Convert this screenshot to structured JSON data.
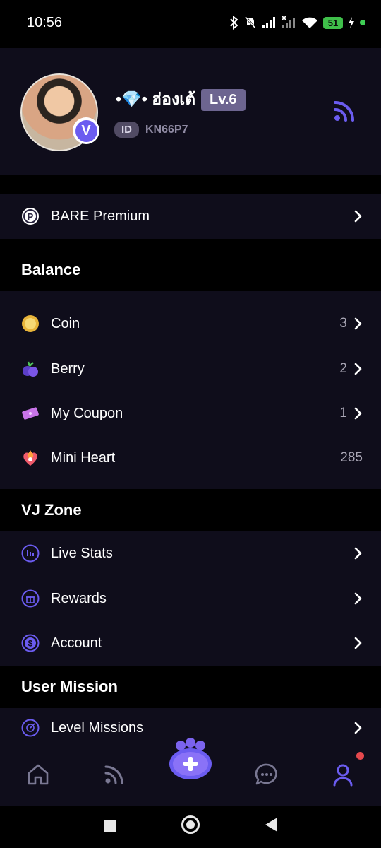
{
  "status_bar": {
    "time": "10:56",
    "battery": "51"
  },
  "profile": {
    "username": "•💎• ฮ่องเต้",
    "level": "Lv.6",
    "id_label": "ID",
    "id_value": "KN66P7"
  },
  "premium": {
    "label": "BARE Premium"
  },
  "balance": {
    "header": "Balance",
    "items": [
      {
        "label": "Coin",
        "count": "3",
        "icon": "coin-icon"
      },
      {
        "label": "Berry",
        "count": "2",
        "icon": "berry-icon"
      },
      {
        "label": "My Coupon",
        "count": "1",
        "icon": "coupon-icon"
      },
      {
        "label": "Mini Heart",
        "count": "285",
        "icon": "mini-heart-icon"
      }
    ]
  },
  "vj_zone": {
    "header": "VJ Zone",
    "items": [
      {
        "label": "Live Stats",
        "icon": "stats-icon"
      },
      {
        "label": "Rewards",
        "icon": "gift-icon"
      },
      {
        "label": "Account",
        "icon": "dollar-icon"
      }
    ]
  },
  "user_mission": {
    "header": "User Mission",
    "items": [
      {
        "label": "Level Missions",
        "icon": "mission-icon"
      }
    ]
  },
  "colors": {
    "accent": "#6b5cf0",
    "panel": "#0f0d1b",
    "background": "#000000",
    "notification": "#e5484d"
  }
}
